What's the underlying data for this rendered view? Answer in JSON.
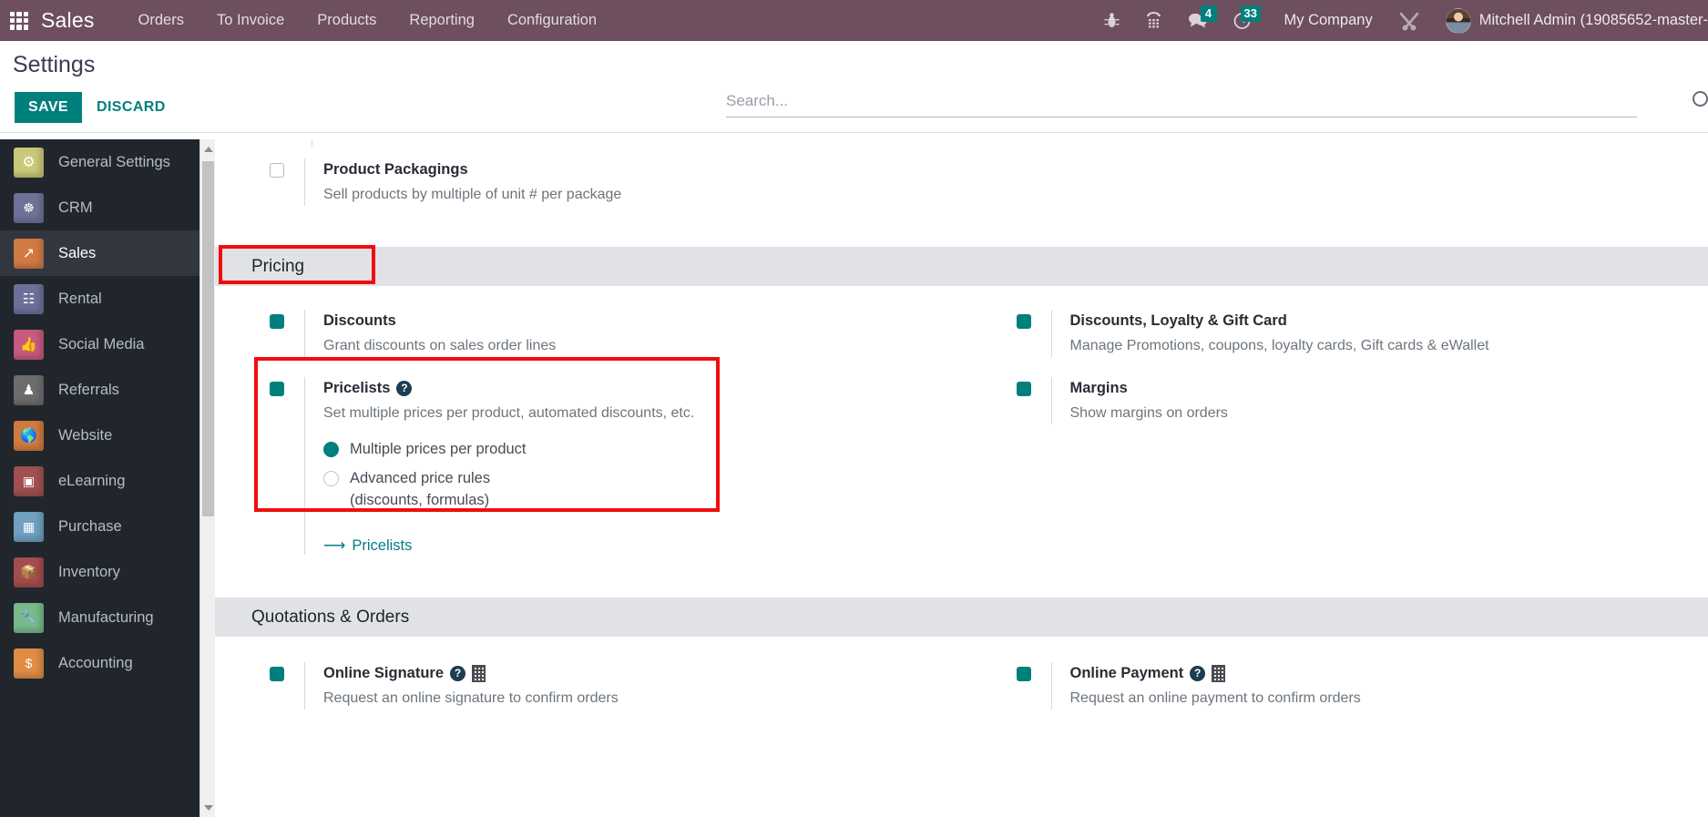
{
  "topbar": {
    "apps_icon": "apps-grid-icon",
    "brand": "Sales",
    "menus": [
      "Orders",
      "To Invoice",
      "Products",
      "Reporting",
      "Configuration"
    ],
    "sys_icons": [
      {
        "name": "bug-icon",
        "glyph": "☣",
        "badge": null
      },
      {
        "name": "phone-dialpad-icon",
        "glyph": "☎",
        "badge": null
      },
      {
        "name": "messages-icon",
        "glyph": "💬",
        "badge": "4"
      },
      {
        "name": "activities-clock-icon",
        "glyph": "🕒",
        "badge": "33"
      }
    ],
    "company": "My Company",
    "tools_icon": "tools-icon",
    "avatar": "user-avatar",
    "user": "Mitchell Admin (19085652-master-",
    "badge_color": "#00807d",
    "bar_color": "#6d4f60"
  },
  "control_panel": {
    "title": "Settings",
    "save_label": "SAVE",
    "discard_label": "DISCARD",
    "search_placeholder": "Search...",
    "search_value": "",
    "search_icon": "search-icon",
    "save_color": "#00807d"
  },
  "sidebar": {
    "items": [
      {
        "label": "General Settings",
        "icon": "gear-icon",
        "glyph": "⚙",
        "bg": "#c9c878",
        "active": false
      },
      {
        "label": "CRM",
        "icon": "handshake-icon",
        "glyph": "🤝",
        "bg": "#6f7296",
        "active": false
      },
      {
        "label": "Sales",
        "icon": "chart-up-icon",
        "glyph": "📈",
        "bg": "#d17a43",
        "active": true
      },
      {
        "label": "Rental",
        "icon": "calendar-icon",
        "glyph": "📅",
        "bg": "#6d7199",
        "active": false
      },
      {
        "label": "Social Media",
        "icon": "thumbs-up-icon",
        "glyph": "👍",
        "bg": "#c75a7e",
        "active": false
      },
      {
        "label": "Referrals",
        "icon": "person-cape-icon",
        "glyph": "🦸",
        "bg": "#6d6d6d",
        "active": false
      },
      {
        "label": "Website",
        "icon": "globe-icon",
        "glyph": "🌐",
        "bg": "#cf7b3e",
        "active": false
      },
      {
        "label": "eLearning",
        "icon": "presentation-icon",
        "glyph": "📽",
        "bg": "#a05050",
        "active": false
      },
      {
        "label": "Purchase",
        "icon": "credit-card-icon",
        "glyph": "💳",
        "bg": "#6fa0c0",
        "active": false
      },
      {
        "label": "Inventory",
        "icon": "box-icon",
        "glyph": "📦",
        "bg": "#a34d4d",
        "active": false
      },
      {
        "label": "Manufacturing",
        "icon": "wrench-icon",
        "glyph": "🔧",
        "bg": "#79b98b",
        "active": false
      },
      {
        "label": "Accounting",
        "icon": "invoice-dollar-icon",
        "glyph": "🧾",
        "bg": "#e08c46",
        "active": false
      }
    ],
    "bg": "#21262d"
  },
  "content": {
    "top_partial": {
      "checkbox_state": "off",
      "title": "Product Packagings",
      "desc": "Sell products by multiple of unit # per package"
    },
    "pricing": {
      "header": "Pricing",
      "left": [
        {
          "checkbox_state": "on",
          "title": "Discounts",
          "desc": "Grant discounts on sales order lines"
        },
        {
          "checkbox_state": "on",
          "title": "Pricelists",
          "has_help": true,
          "desc": "Set multiple prices per product, automated discounts, etc.",
          "radios": [
            {
              "label": "Multiple prices per product",
              "selected": true
            },
            {
              "label": "Advanced price rules",
              "label2": "(discounts, formulas)",
              "selected": false
            }
          ],
          "link": "Pricelists"
        }
      ],
      "right": [
        {
          "checkbox_state": "on",
          "title": "Discounts, Loyalty & Gift Card",
          "desc": "Manage Promotions, coupons, loyalty cards, Gift cards & eWallet"
        },
        {
          "checkbox_state": "on",
          "title": "Margins",
          "desc": "Show margins on orders"
        }
      ]
    },
    "quotations": {
      "header": "Quotations & Orders",
      "left": {
        "checkbox_state": "on",
        "title": "Online Signature",
        "has_help": true,
        "has_company": true,
        "desc": "Request an online signature to confirm orders"
      },
      "right": {
        "checkbox_state": "on",
        "title": "Online Payment",
        "has_help": true,
        "has_company": true,
        "desc": "Request an online payment to confirm orders"
      }
    },
    "annotations": [
      {
        "name": "pricing-highlight",
        "color": "#f20d0d"
      },
      {
        "name": "pricelists-highlight",
        "color": "#f20d0d"
      }
    ],
    "accent_color": "#00807d",
    "section_bg": "#e0e2e6"
  }
}
